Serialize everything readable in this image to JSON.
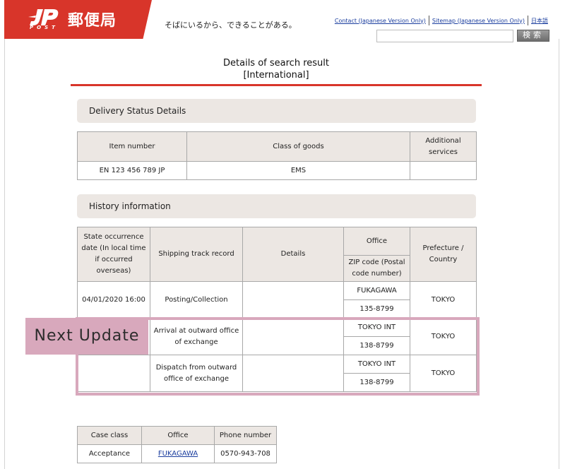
{
  "header": {
    "logo_text": "郵便局",
    "logo_post": "POST",
    "tagline": "そばにいるから、できることがある。",
    "links": [
      "Contact (Japanese Version Only)",
      "Sitemap (Japanese Version Only)",
      "日本語"
    ],
    "search_button": "検索",
    "brand_color": "#d8352a"
  },
  "page": {
    "title_line1": "Details of search result",
    "title_line2": "[International]"
  },
  "delivery_status": {
    "section_title": "Delivery Status Details",
    "headers": [
      "Item number",
      "Class of goods",
      "Additional services"
    ],
    "row": [
      "EN 123 456 789 JP",
      "EMS",
      ""
    ]
  },
  "history": {
    "section_title": "History information",
    "headers": {
      "date": "State occurrence date (In local time if occurred overseas)",
      "record": "Shipping track record",
      "details": "Details",
      "office": "Office",
      "zip": "ZIP code (Postal code number)",
      "prefecture": "Prefecture / Country"
    },
    "rows": [
      {
        "date": "04/01/2020 16:00",
        "record": "Posting/Collection",
        "details": "",
        "office": "FUKAGAWA",
        "zip": "135-8799",
        "prefecture": "TOKYO"
      },
      {
        "date": "",
        "record": "Arrival at outward office of exchange",
        "details": "",
        "office": "TOKYO INT",
        "zip": "138-8799",
        "prefecture": "TOKYO"
      },
      {
        "date": "",
        "record": "Dispatch from outward office of exchange",
        "details": "",
        "office": "TOKYO INT",
        "zip": "138-8799",
        "prefecture": "TOKYO"
      }
    ],
    "next_update_label": "Next Update",
    "highlight_color": "#d8a8bc"
  },
  "contact": {
    "headers": [
      "Case class",
      "Office",
      "Phone number"
    ],
    "row": [
      "Acceptance",
      "FUKAGAWA",
      "0570-943-708"
    ]
  }
}
